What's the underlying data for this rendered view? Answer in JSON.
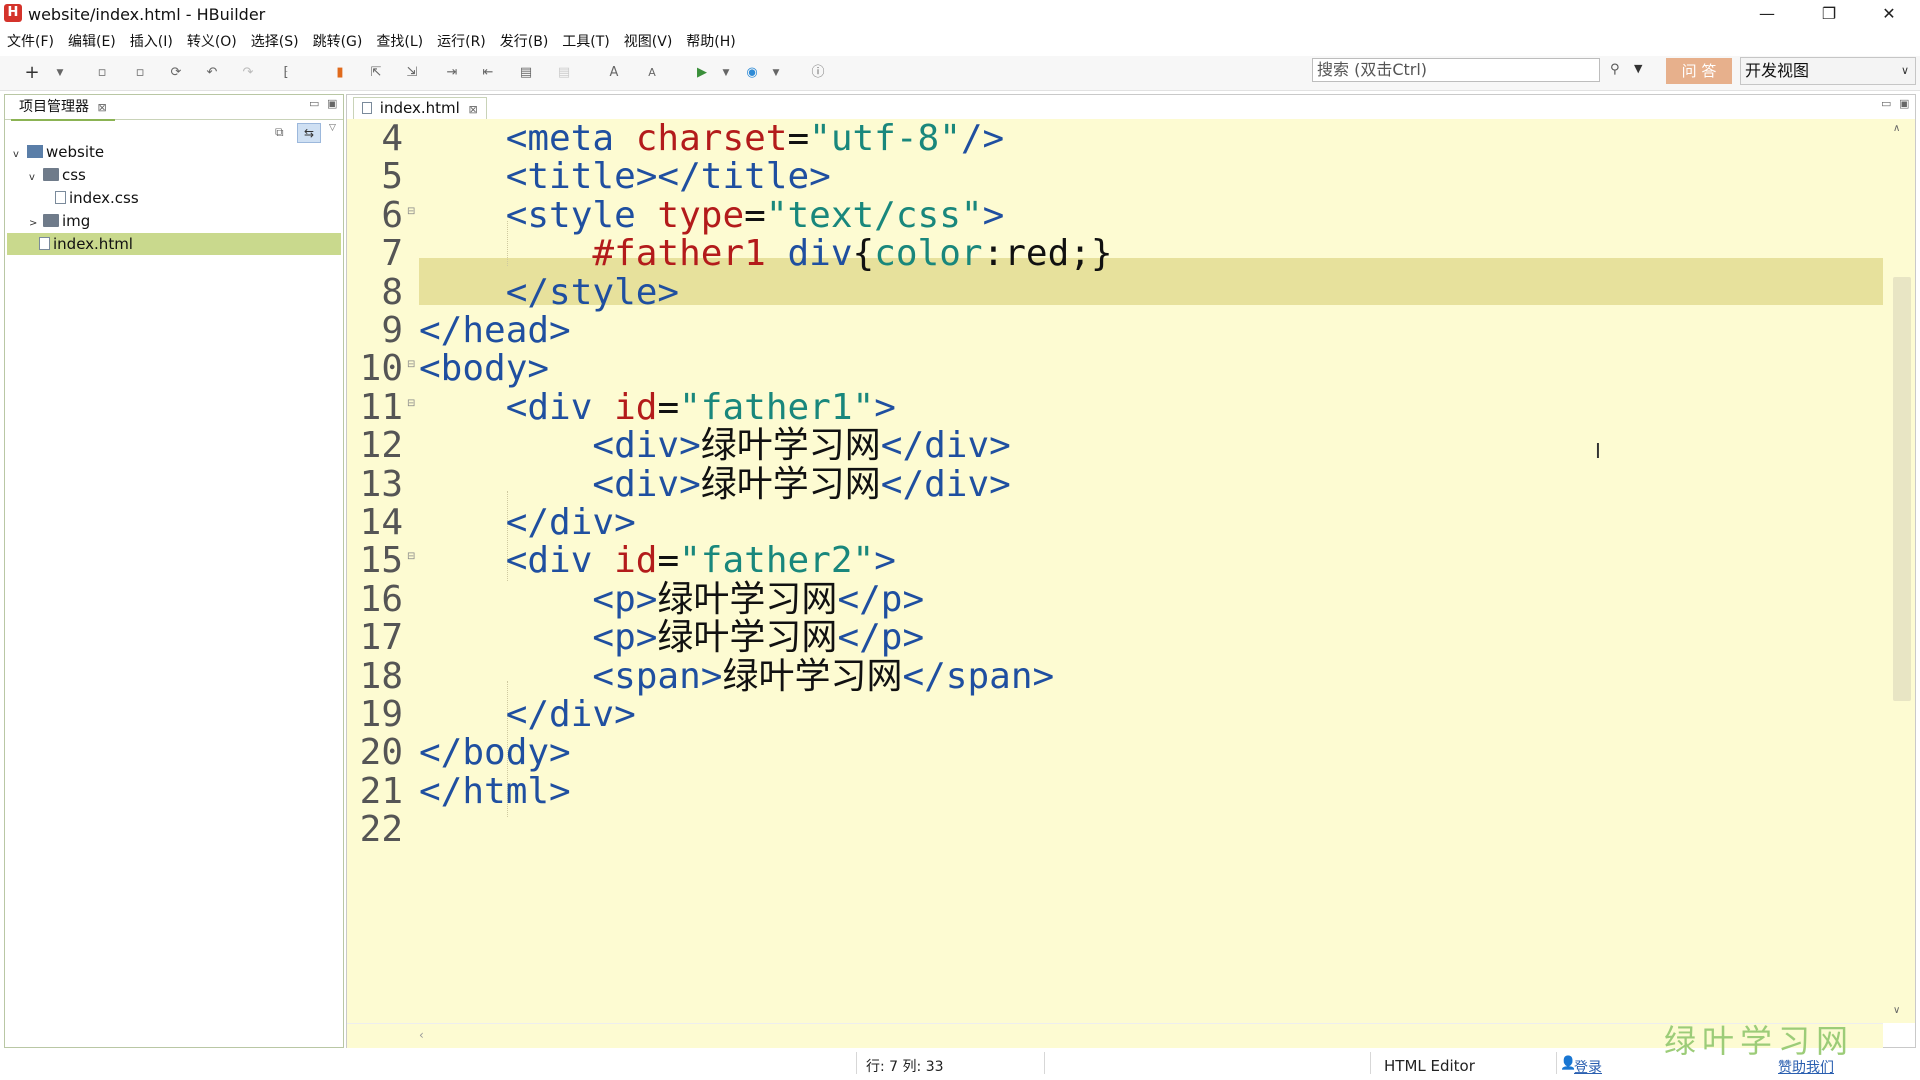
{
  "window": {
    "title": "website/index.html  -  HBuilder",
    "app_icon": "H",
    "minimize": "—",
    "restore": "❐",
    "close": "✕"
  },
  "menu": [
    "文件(F)",
    "编辑(E)",
    "插入(I)",
    "转义(O)",
    "选择(S)",
    "跳转(G)",
    "查找(L)",
    "运行(R)",
    "发行(B)",
    "工具(T)",
    "视图(V)",
    "帮助(H)"
  ],
  "toolbar": {
    "search_placeholder": "搜索  (双击Ctrl)",
    "ask_button": "问 答",
    "view_select": "开发视图"
  },
  "explorer": {
    "tab_label": "项目管理器",
    "tree": [
      {
        "label": "website",
        "type": "project",
        "twisty": "v",
        "expanded": true
      },
      {
        "label": "css",
        "type": "folder",
        "twisty": "v",
        "expanded": true
      },
      {
        "label": "index.css",
        "type": "file"
      },
      {
        "label": "img",
        "type": "folder",
        "twisty": ">",
        "expanded": false
      },
      {
        "label": "index.html",
        "type": "file",
        "selected": true
      }
    ]
  },
  "editor": {
    "tab_label": "index.html",
    "current_line": 7,
    "lines": [
      {
        "n": "4",
        "tokens": [
          [
            "plain",
            "    "
          ],
          [
            "tag",
            "<meta "
          ],
          [
            "attr",
            "charset"
          ],
          [
            "plain",
            "="
          ],
          [
            "str",
            "\"utf-8\""
          ],
          [
            "tag",
            "/>"
          ]
        ]
      },
      {
        "n": "5",
        "tokens": [
          [
            "plain",
            "    "
          ],
          [
            "tag",
            "<title></title>"
          ]
        ]
      },
      {
        "n": "6",
        "fold": true,
        "tokens": [
          [
            "plain",
            "    "
          ],
          [
            "tag",
            "<style "
          ],
          [
            "attr",
            "type"
          ],
          [
            "plain",
            "="
          ],
          [
            "str",
            "\"text/css\""
          ],
          [
            "tag",
            ">"
          ]
        ]
      },
      {
        "n": "7",
        "tokens": [
          [
            "plain",
            "        "
          ],
          [
            "sel",
            "#father1 "
          ],
          [
            "tag",
            "div"
          ],
          [
            "plain",
            "{"
          ],
          [
            "str",
            "color"
          ],
          [
            "plain",
            ":red;}"
          ]
        ]
      },
      {
        "n": "8",
        "tokens": [
          [
            "plain",
            "    "
          ],
          [
            "tag",
            "</style>"
          ]
        ]
      },
      {
        "n": "9",
        "tokens": [
          [
            "tag",
            "</head>"
          ]
        ]
      },
      {
        "n": "10",
        "fold": true,
        "tokens": [
          [
            "tag",
            "<body>"
          ]
        ]
      },
      {
        "n": "11",
        "fold": true,
        "tokens": [
          [
            "plain",
            "    "
          ],
          [
            "tag",
            "<div "
          ],
          [
            "attr",
            "id"
          ],
          [
            "plain",
            "="
          ],
          [
            "str",
            "\"father1\""
          ],
          [
            "tag",
            ">"
          ]
        ]
      },
      {
        "n": "12",
        "tokens": [
          [
            "plain",
            "        "
          ],
          [
            "tag",
            "<div>"
          ],
          [
            "plain",
            "绿叶学习网"
          ],
          [
            "tag",
            "</div>"
          ]
        ]
      },
      {
        "n": "13",
        "tokens": [
          [
            "plain",
            "        "
          ],
          [
            "tag",
            "<div>"
          ],
          [
            "plain",
            "绿叶学习网"
          ],
          [
            "tag",
            "</div>"
          ]
        ]
      },
      {
        "n": "14",
        "tokens": [
          [
            "plain",
            "    "
          ],
          [
            "tag",
            "</div>"
          ]
        ]
      },
      {
        "n": "15",
        "fold": true,
        "tokens": [
          [
            "plain",
            "    "
          ],
          [
            "tag",
            "<div "
          ],
          [
            "attr",
            "id"
          ],
          [
            "plain",
            "="
          ],
          [
            "str",
            "\"father2\""
          ],
          [
            "tag",
            ">"
          ]
        ]
      },
      {
        "n": "16",
        "tokens": [
          [
            "plain",
            "        "
          ],
          [
            "tag",
            "<p>"
          ],
          [
            "plain",
            "绿叶学习网"
          ],
          [
            "tag",
            "</p>"
          ]
        ]
      },
      {
        "n": "17",
        "tokens": [
          [
            "plain",
            "        "
          ],
          [
            "tag",
            "<p>"
          ],
          [
            "plain",
            "绿叶学习网"
          ],
          [
            "tag",
            "</p>"
          ]
        ]
      },
      {
        "n": "18",
        "tokens": [
          [
            "plain",
            "        "
          ],
          [
            "tag",
            "<span>"
          ],
          [
            "plain",
            "绿叶学习网"
          ],
          [
            "tag",
            "</span>"
          ]
        ]
      },
      {
        "n": "19",
        "tokens": [
          [
            "plain",
            "    "
          ],
          [
            "tag",
            "</div>"
          ]
        ]
      },
      {
        "n": "20",
        "tokens": [
          [
            "tag",
            "</body>"
          ]
        ]
      },
      {
        "n": "21",
        "tokens": [
          [
            "tag",
            "</html>"
          ]
        ]
      },
      {
        "n": "22",
        "tokens": []
      }
    ]
  },
  "status": {
    "position": "行: 7 列: 33",
    "editor_type": "HTML Editor",
    "login": "登录",
    "help": "赞助我们"
  },
  "watermark": "绿叶学习网",
  "colors": {
    "editor_bg": "#fdfbd2",
    "current_line_bg": "#e7e19c",
    "tag": "#1f4fa0",
    "attribute": "#b31b1b",
    "string": "#19877c",
    "selection_accent": "#c9d98d"
  }
}
